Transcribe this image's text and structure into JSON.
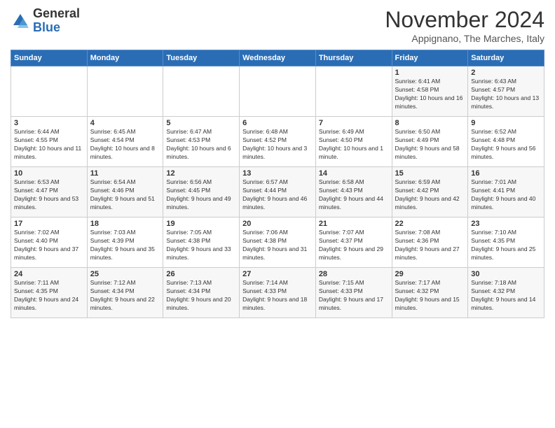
{
  "logo": {
    "general": "General",
    "blue": "Blue"
  },
  "title": "November 2024",
  "location": "Appignano, The Marches, Italy",
  "days_of_week": [
    "Sunday",
    "Monday",
    "Tuesday",
    "Wednesday",
    "Thursday",
    "Friday",
    "Saturday"
  ],
  "weeks": [
    [
      {
        "day": "",
        "info": ""
      },
      {
        "day": "",
        "info": ""
      },
      {
        "day": "",
        "info": ""
      },
      {
        "day": "",
        "info": ""
      },
      {
        "day": "",
        "info": ""
      },
      {
        "day": "1",
        "info": "Sunrise: 6:41 AM\nSunset: 4:58 PM\nDaylight: 10 hours and 16 minutes."
      },
      {
        "day": "2",
        "info": "Sunrise: 6:43 AM\nSunset: 4:57 PM\nDaylight: 10 hours and 13 minutes."
      }
    ],
    [
      {
        "day": "3",
        "info": "Sunrise: 6:44 AM\nSunset: 4:55 PM\nDaylight: 10 hours and 11 minutes."
      },
      {
        "day": "4",
        "info": "Sunrise: 6:45 AM\nSunset: 4:54 PM\nDaylight: 10 hours and 8 minutes."
      },
      {
        "day": "5",
        "info": "Sunrise: 6:47 AM\nSunset: 4:53 PM\nDaylight: 10 hours and 6 minutes."
      },
      {
        "day": "6",
        "info": "Sunrise: 6:48 AM\nSunset: 4:52 PM\nDaylight: 10 hours and 3 minutes."
      },
      {
        "day": "7",
        "info": "Sunrise: 6:49 AM\nSunset: 4:50 PM\nDaylight: 10 hours and 1 minute."
      },
      {
        "day": "8",
        "info": "Sunrise: 6:50 AM\nSunset: 4:49 PM\nDaylight: 9 hours and 58 minutes."
      },
      {
        "day": "9",
        "info": "Sunrise: 6:52 AM\nSunset: 4:48 PM\nDaylight: 9 hours and 56 minutes."
      }
    ],
    [
      {
        "day": "10",
        "info": "Sunrise: 6:53 AM\nSunset: 4:47 PM\nDaylight: 9 hours and 53 minutes."
      },
      {
        "day": "11",
        "info": "Sunrise: 6:54 AM\nSunset: 4:46 PM\nDaylight: 9 hours and 51 minutes."
      },
      {
        "day": "12",
        "info": "Sunrise: 6:56 AM\nSunset: 4:45 PM\nDaylight: 9 hours and 49 minutes."
      },
      {
        "day": "13",
        "info": "Sunrise: 6:57 AM\nSunset: 4:44 PM\nDaylight: 9 hours and 46 minutes."
      },
      {
        "day": "14",
        "info": "Sunrise: 6:58 AM\nSunset: 4:43 PM\nDaylight: 9 hours and 44 minutes."
      },
      {
        "day": "15",
        "info": "Sunrise: 6:59 AM\nSunset: 4:42 PM\nDaylight: 9 hours and 42 minutes."
      },
      {
        "day": "16",
        "info": "Sunrise: 7:01 AM\nSunset: 4:41 PM\nDaylight: 9 hours and 40 minutes."
      }
    ],
    [
      {
        "day": "17",
        "info": "Sunrise: 7:02 AM\nSunset: 4:40 PM\nDaylight: 9 hours and 37 minutes."
      },
      {
        "day": "18",
        "info": "Sunrise: 7:03 AM\nSunset: 4:39 PM\nDaylight: 9 hours and 35 minutes."
      },
      {
        "day": "19",
        "info": "Sunrise: 7:05 AM\nSunset: 4:38 PM\nDaylight: 9 hours and 33 minutes."
      },
      {
        "day": "20",
        "info": "Sunrise: 7:06 AM\nSunset: 4:38 PM\nDaylight: 9 hours and 31 minutes."
      },
      {
        "day": "21",
        "info": "Sunrise: 7:07 AM\nSunset: 4:37 PM\nDaylight: 9 hours and 29 minutes."
      },
      {
        "day": "22",
        "info": "Sunrise: 7:08 AM\nSunset: 4:36 PM\nDaylight: 9 hours and 27 minutes."
      },
      {
        "day": "23",
        "info": "Sunrise: 7:10 AM\nSunset: 4:35 PM\nDaylight: 9 hours and 25 minutes."
      }
    ],
    [
      {
        "day": "24",
        "info": "Sunrise: 7:11 AM\nSunset: 4:35 PM\nDaylight: 9 hours and 24 minutes."
      },
      {
        "day": "25",
        "info": "Sunrise: 7:12 AM\nSunset: 4:34 PM\nDaylight: 9 hours and 22 minutes."
      },
      {
        "day": "26",
        "info": "Sunrise: 7:13 AM\nSunset: 4:34 PM\nDaylight: 9 hours and 20 minutes."
      },
      {
        "day": "27",
        "info": "Sunrise: 7:14 AM\nSunset: 4:33 PM\nDaylight: 9 hours and 18 minutes."
      },
      {
        "day": "28",
        "info": "Sunrise: 7:15 AM\nSunset: 4:33 PM\nDaylight: 9 hours and 17 minutes."
      },
      {
        "day": "29",
        "info": "Sunrise: 7:17 AM\nSunset: 4:32 PM\nDaylight: 9 hours and 15 minutes."
      },
      {
        "day": "30",
        "info": "Sunrise: 7:18 AM\nSunset: 4:32 PM\nDaylight: 9 hours and 14 minutes."
      }
    ]
  ]
}
